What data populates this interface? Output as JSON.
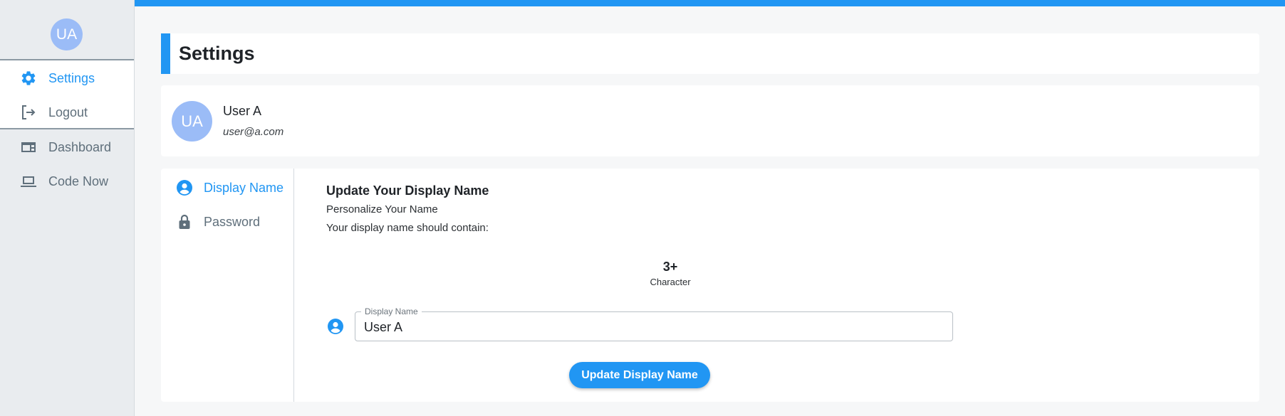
{
  "sidebar": {
    "avatar_initials": "UA",
    "items": [
      {
        "label": "Settings",
        "icon": "gear-icon",
        "active": true
      },
      {
        "label": "Logout",
        "icon": "logout-icon",
        "active": false
      },
      {
        "label": "Dashboard",
        "icon": "dashboard-icon",
        "active": false
      },
      {
        "label": "Code Now",
        "icon": "laptop-icon",
        "active": false
      }
    ]
  },
  "colors": {
    "accent": "#2196f3",
    "avatar": "#9bbcf7",
    "sidebar_bg": "#e9ecef",
    "muted_text": "#5f6f7b"
  },
  "page": {
    "title": "Settings"
  },
  "profile": {
    "initials": "UA",
    "name": "User A",
    "email": "user@a.com"
  },
  "settings_nav": {
    "items": [
      {
        "label": "Display Name",
        "icon": "account-circle-icon",
        "active": true
      },
      {
        "label": "Password",
        "icon": "lock-icon",
        "active": false
      }
    ]
  },
  "display_name_form": {
    "heading": "Update Your Display Name",
    "subheading": "Personalize Your Name",
    "requirements_intro": "Your display name should contain:",
    "requirement": {
      "value": "3+",
      "label": "Character"
    },
    "field_label": "Display Name",
    "field_value": "User A",
    "submit_label": "Update Display Name"
  }
}
